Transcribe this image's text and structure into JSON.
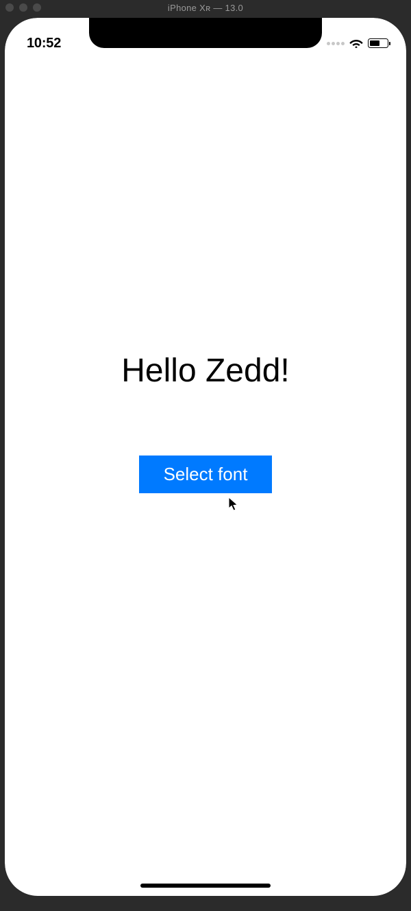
{
  "mac_window": {
    "title": "iPhone Xʀ — 13.0"
  },
  "status_bar": {
    "time": "10:52"
  },
  "content": {
    "heading": "Hello Zedd!",
    "button_label": "Select font"
  }
}
